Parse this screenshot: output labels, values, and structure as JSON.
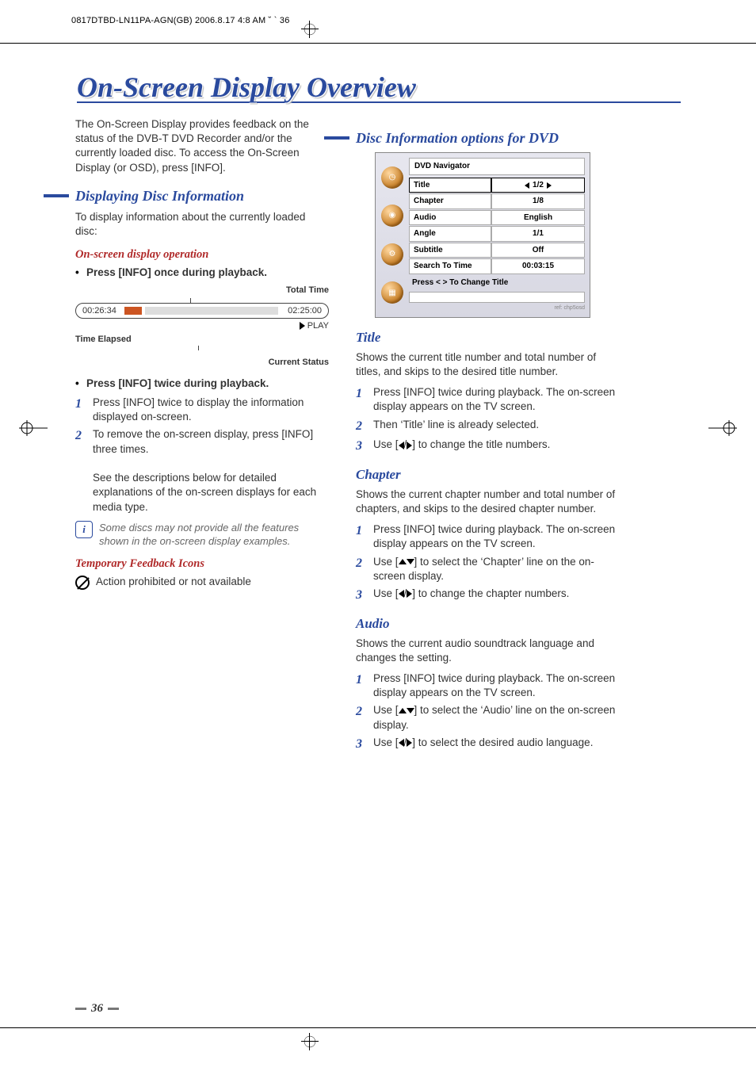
{
  "header_stamp": "0817DTBD-LN11PA-AGN(GB)  2006.8.17 4:8 AM  ˘ ` 36",
  "page_title": "On-Screen Display Overview",
  "intro": "The On-Screen Display provides feedback on the status of the DVB-T DVD Recorder and/or the currently loaded disc. To access the On-Screen Display (or OSD), press [INFO].",
  "left": {
    "h_display": "Displaying Disc Information",
    "p_display": "To display information about the currently loaded disc:",
    "h_op": "On-screen display operation",
    "bullet_once": "Press [INFO] once during playback.",
    "pb": {
      "total_label": "Total Time",
      "elapsed": "00:26:34",
      "total": "02:25:00",
      "play": "PLAY",
      "elapsed_label": "Time Elapsed",
      "status_label": "Current Status"
    },
    "bullet_twice": "Press [INFO] twice during playback.",
    "step1": "Press [INFO] twice to display the information displayed on-screen.",
    "step2": "To remove the on-screen display, press [INFO] three times.",
    "step2b": "See the descriptions below for detailed explanations of the on-screen displays for each media type.",
    "note": "Some discs may not provide all the features shown in the on-screen display examples.",
    "h_temp": "Temporary Feedback Icons",
    "prohibit": "Action prohibited or not available"
  },
  "right": {
    "h_opts": "Disc Information options for DVD",
    "nav": {
      "title": "DVD Navigator",
      "rows": [
        {
          "k": "Title",
          "v": "1/2",
          "hl": true,
          "arrows": true
        },
        {
          "k": "Chapter",
          "v": "1/8"
        },
        {
          "k": "Audio",
          "v": "English"
        },
        {
          "k": "Angle",
          "v": "1/1"
        },
        {
          "k": "Subtitle",
          "v": "Off"
        },
        {
          "k": "Search To Time",
          "v": "00:03:15"
        }
      ],
      "hint": "Press < > To  Change Title",
      "foot": "ref: chp5osd"
    },
    "title": {
      "h": "Title",
      "p": "Shows the current title number and total number of titles, and skips to the desired title number.",
      "s1": "Press [INFO] twice during playback. The on-screen display appears on the TV screen.",
      "s2": "Then ‘Title’ line is already selected.",
      "s3_pre": "Use [",
      "s3_post": "] to change the title numbers."
    },
    "chapter": {
      "h": "Chapter",
      "p": "Shows the current chapter number and total number of chapters, and skips to the desired chapter number.",
      "s1": "Press [INFO] twice during playback. The on-screen display appears on the TV screen.",
      "s2_pre": "Use [",
      "s2_mid": "] to select the ‘Chapter’ line on the on-screen display.",
      "s3_pre": "Use [",
      "s3_post": "] to change the chapter numbers."
    },
    "audio": {
      "h": "Audio",
      "p": "Shows the current audio soundtrack language and changes the setting.",
      "s1": "Press [INFO] twice during playback. The on-screen display appears on the TV screen.",
      "s2_pre": "Use [",
      "s2_mid": "] to select the ‘Audio’ line on the on-screen display.",
      "s3_pre": "Use [",
      "s3_post": "] to select the desired audio language."
    }
  },
  "page_number": "36"
}
